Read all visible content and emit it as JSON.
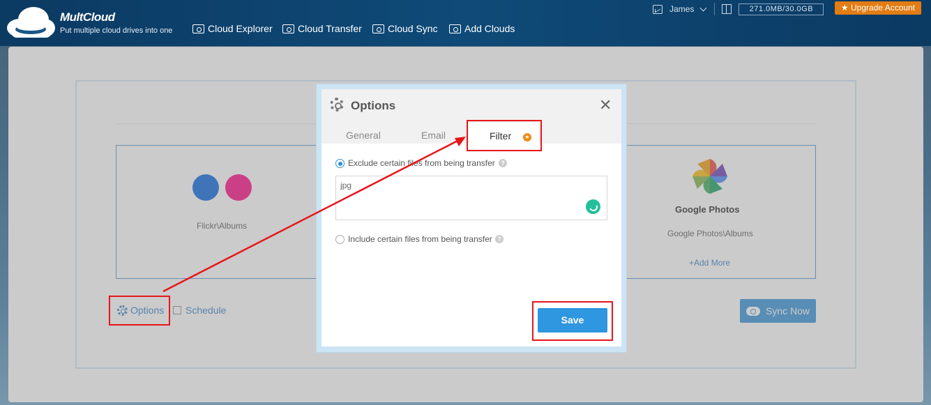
{
  "header": {
    "logo_name": "MultCloud",
    "logo_tagline": "Put multiple cloud drives into one",
    "nav": [
      {
        "label": "Cloud Explorer",
        "icon": "cloud-explorer-icon"
      },
      {
        "label": "Cloud Transfer",
        "icon": "cloud-transfer-icon"
      },
      {
        "label": "Cloud Sync",
        "icon": "cloud-sync-icon"
      },
      {
        "label": "Add Clouds",
        "icon": "add-clouds-icon"
      }
    ],
    "user_name": "James",
    "storage": "271.0MB/30.0GB",
    "upgrade_label": "★ Upgrade Account"
  },
  "sync_page": {
    "source_path": "Flickr\\Albums",
    "target_title": "Google Photos",
    "target_path": "Google Photos\\Albums",
    "add_more": "+Add More",
    "options_label": "Options",
    "schedule_label": "Schedule",
    "sync_now_label": "Sync Now"
  },
  "dialog": {
    "title": "Options",
    "close_label": "✕",
    "tabs": [
      "General",
      "Email",
      "Filter"
    ],
    "active_tab": "Filter",
    "pro_badge": "★",
    "exclude_label": "Exclude certain files from being transfer",
    "exclude_selected": true,
    "exclude_value": "jpg",
    "include_label": "Include certain files from being transfer",
    "help_glyph": "?",
    "save_label": "Save"
  },
  "colors": {
    "accent": "#2f8fd8",
    "highlight_red": "#e8141a",
    "upgrade_orange": "#e27c13"
  }
}
